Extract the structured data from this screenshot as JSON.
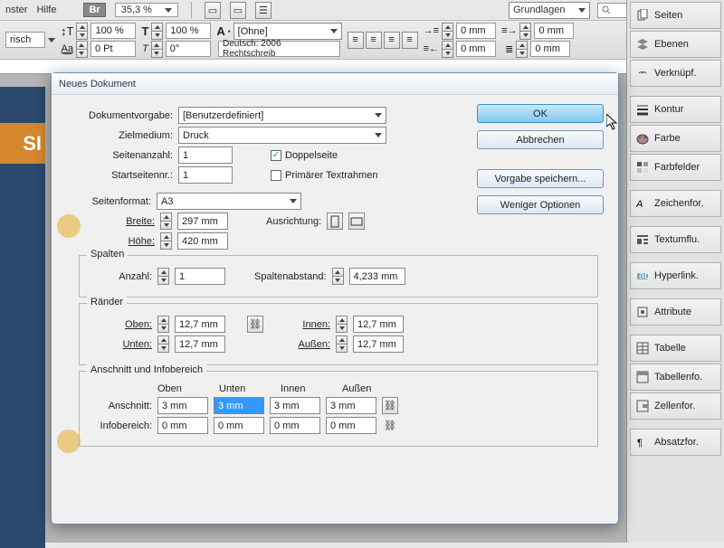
{
  "menu": {
    "item1": "nster",
    "item2": "Hilfe",
    "br": "Br",
    "zoom": "35,3 %",
    "layout": "Grundlagen"
  },
  "toolbar": {
    "combo1": "risch",
    "pct1": "100 %",
    "pct2": "100 %",
    "char": "A",
    "ohne": "[Ohne]",
    "pt": "0 Pt",
    "deg": "0°",
    "lang": "Deutsch: 2006 Rechtschreib",
    "mm": "0 mm"
  },
  "dialog": {
    "title": "Neues Dokument",
    "preset_label": "Dokumentvorgabe:",
    "preset": "[Benutzerdefiniert]",
    "intent_label": "Zielmedium:",
    "intent": "Druck",
    "pages_label": "Seitenanzahl:",
    "pages": "1",
    "facing": "Doppelseite",
    "startpg_label": "Startseitennr.:",
    "startpg": "1",
    "primary": "Primärer Textrahmen",
    "size_label": "Seitenformat:",
    "size": "A3",
    "width_label": "Breite:",
    "width": "297 mm",
    "height_label": "Höhe:",
    "height": "420 mm",
    "orient_label": "Ausrichtung:",
    "cols": {
      "title": "Spalten",
      "count_label": "Anzahl:",
      "count": "1",
      "gutter_label": "Spaltenabstand:",
      "gutter": "4,233 mm"
    },
    "margins": {
      "title": "Ränder",
      "top_label": "Oben:",
      "top": "12,7 mm",
      "bottom_label": "Unten:",
      "bottom": "12,7 mm",
      "in_label": "Innen:",
      "in": "12,7 mm",
      "out_label": "Außen:",
      "out": "12,7 mm"
    },
    "bleed": {
      "title": "Anschnitt und Infobereich",
      "c1": "Oben",
      "c2": "Unten",
      "c3": "Innen",
      "c4": "Außen",
      "bleed_label": "Anschnitt:",
      "b1": "3 mm",
      "b2": "3 mm",
      "b3": "3 mm",
      "b4": "3 mm",
      "slug_label": "Infobereich:",
      "s1": "0 mm",
      "s2": "0 mm",
      "s3": "0 mm",
      "s4": "0 mm"
    },
    "buttons": {
      "ok": "OK",
      "cancel": "Abbrechen",
      "save": "Vorgabe speichern...",
      "fewer": "Weniger Optionen"
    }
  },
  "panels": [
    "Seiten",
    "Ebenen",
    "Verknüpf.",
    "Kontur",
    "Farbe",
    "Farbfelder",
    "Zeichenfor.",
    "Textumflu.",
    "Hyperlink.",
    "Attribute",
    "Tabelle",
    "Tabellenfo.",
    "Zellenfor.",
    "Absatzfor."
  ],
  "docpeek": {
    "orange": "SI"
  }
}
